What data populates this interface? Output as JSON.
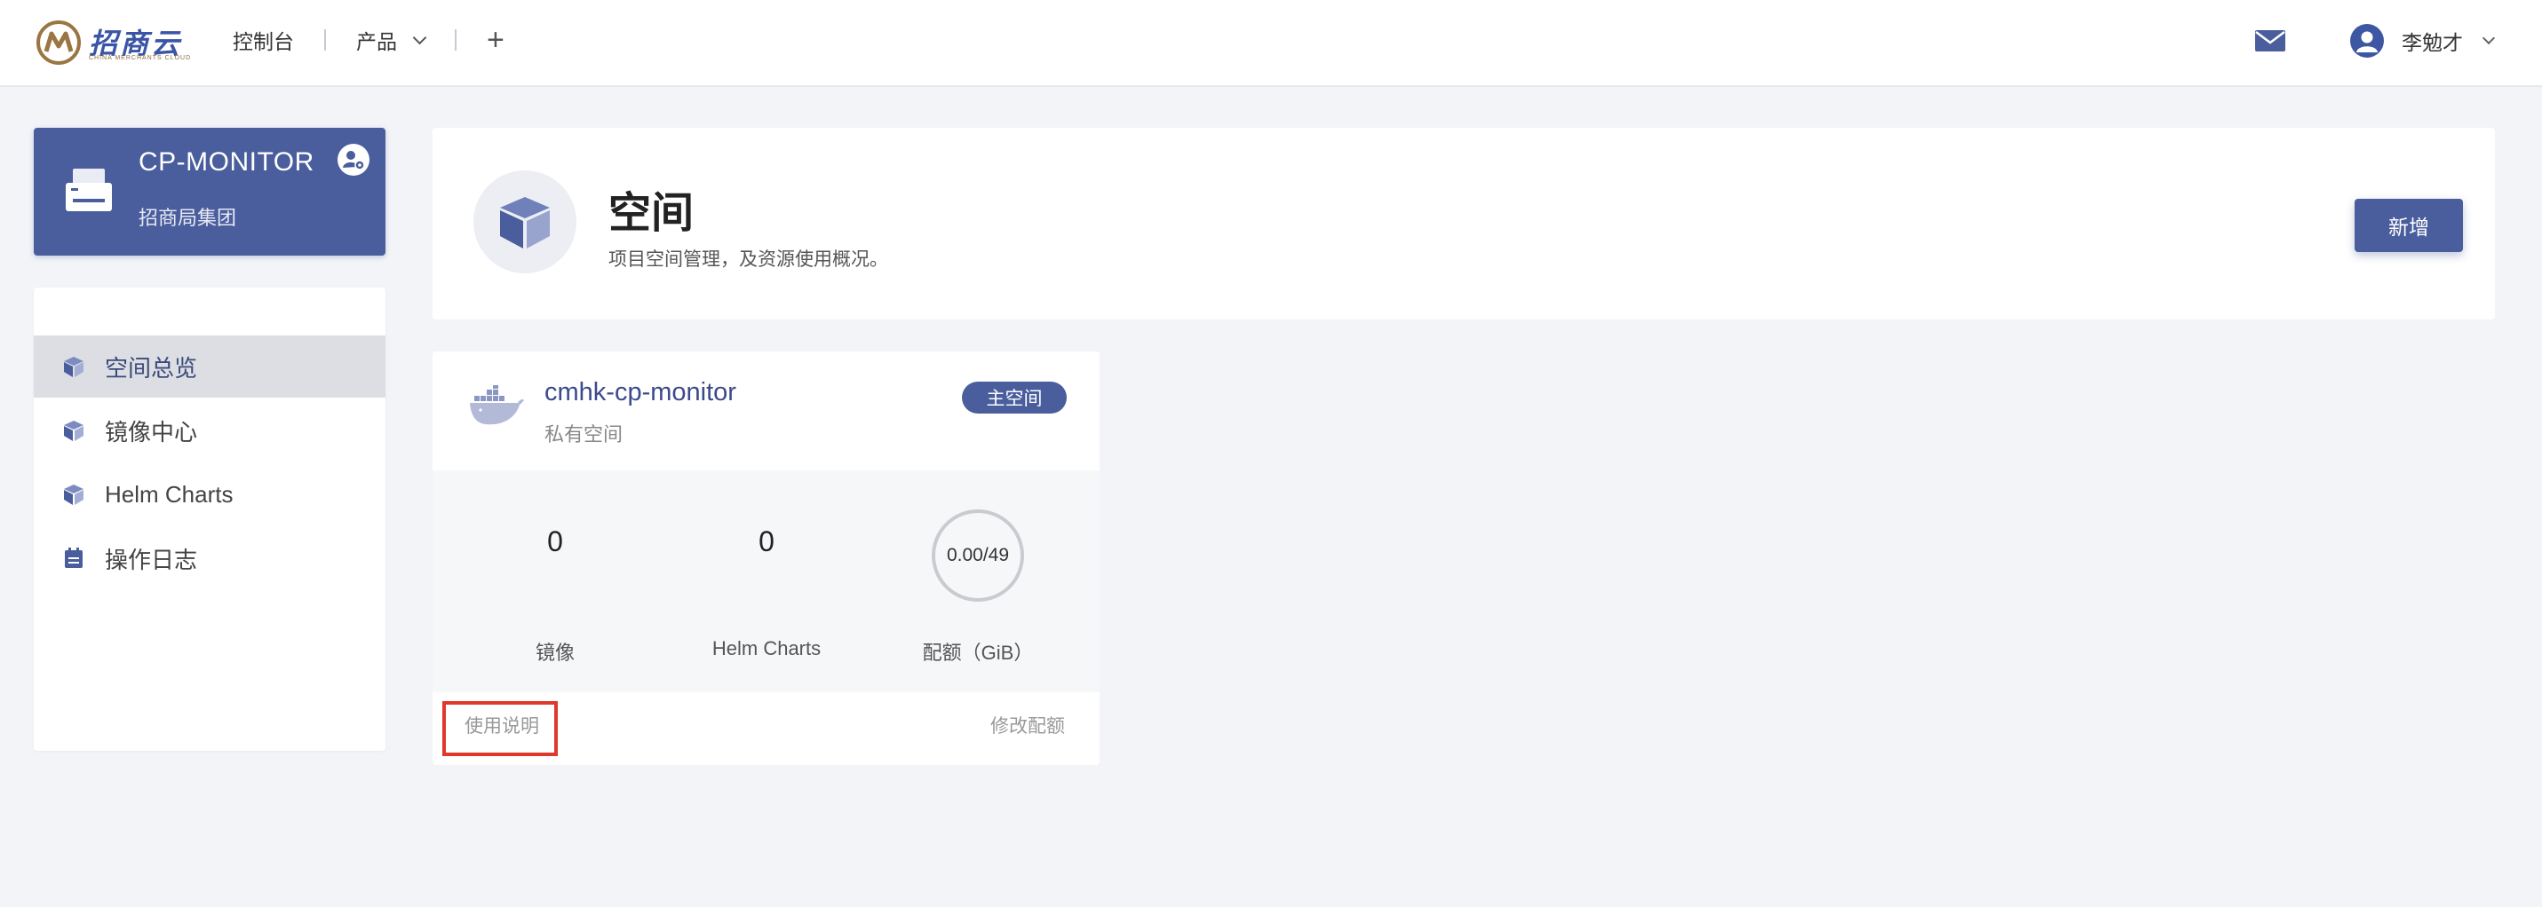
{
  "header": {
    "logo_text": "招商云",
    "logo_subtitle": "CHINA MERCHANTS CLOUD",
    "nav": {
      "console": "控制台",
      "products": "产品",
      "add": "+"
    },
    "user_name": "李勉才"
  },
  "project": {
    "name": "CP-MONITOR",
    "org": "招商局集团"
  },
  "sidebar": {
    "items": [
      {
        "label": "空间总览",
        "active": true
      },
      {
        "label": "镜像中心",
        "active": false
      },
      {
        "label": "Helm Charts",
        "active": false
      },
      {
        "label": "操作日志",
        "active": false
      }
    ]
  },
  "page": {
    "title": "空间",
    "description": "项目空间管理，及资源使用概况。",
    "add_button": "新增"
  },
  "repo": {
    "name": "cmhk-cp-monitor",
    "type": "私有空间",
    "badge": "主空间",
    "stats": {
      "images_count": "0",
      "images_label": "镜像",
      "charts_count": "0",
      "charts_label": "Helm Charts",
      "quota_value": "0.00/49",
      "quota_label": "配额（GiB）"
    },
    "help_link": "使用说明",
    "quota_link": "修改配额"
  },
  "colors": {
    "primary": "#4a5d9c",
    "background": "#f2f4f8",
    "highlight": "#e0382a"
  }
}
